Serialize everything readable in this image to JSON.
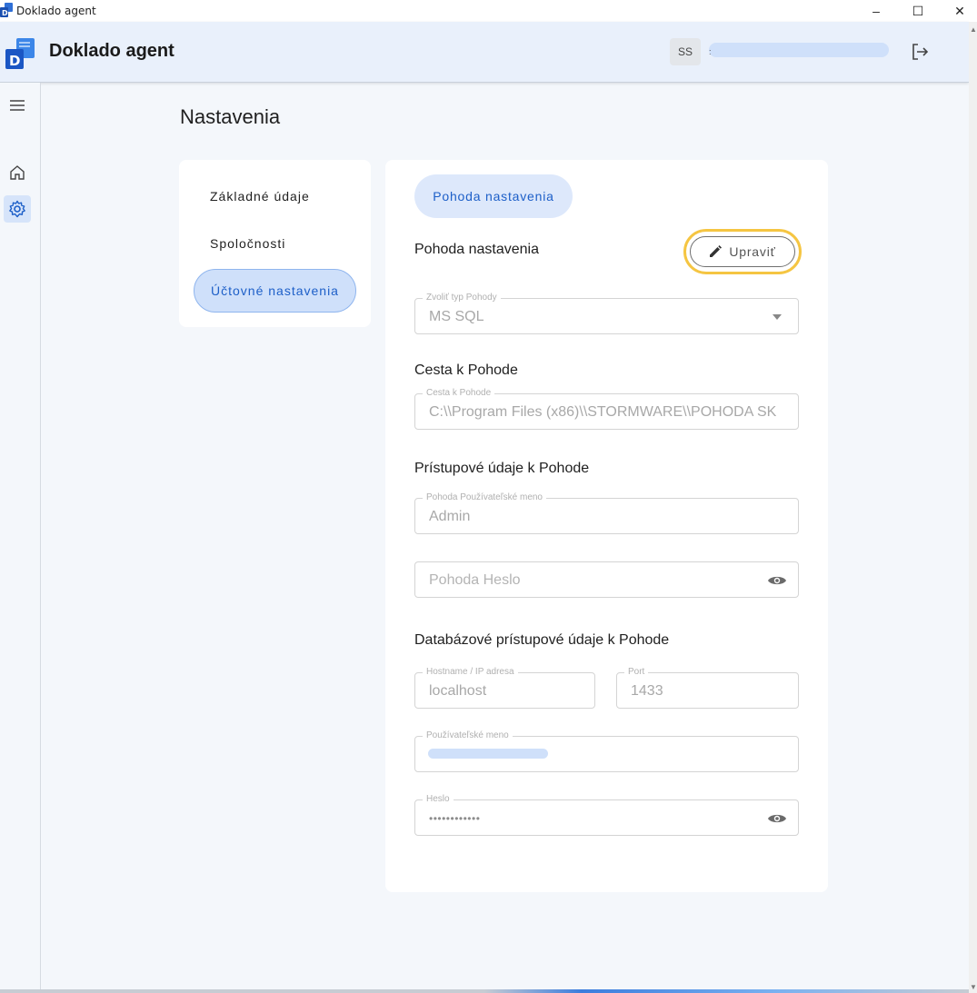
{
  "window": {
    "title": "Doklado agent",
    "minimize": "–",
    "maximize": "☐",
    "close": "✕"
  },
  "header": {
    "app_title": "Doklado agent",
    "avatar_initials": "SS",
    "logout_icon": "logout-icon"
  },
  "sidebar": {
    "icons": [
      "menu-icon",
      "home-icon",
      "settings-icon"
    ]
  },
  "page": {
    "title": "Nastavenia"
  },
  "settings_nav": {
    "items": [
      {
        "label": "Základné údaje"
      },
      {
        "label": "Spoločnosti"
      },
      {
        "label": "Účtovné nastavenia",
        "active": true
      }
    ]
  },
  "card": {
    "chip_label": "Pohoda nastavenia",
    "section_pohoda": "Pohoda nastavenia",
    "edit_label": "Upraviť",
    "type_field": {
      "label": "Zvoliť typ Pohody",
      "value": "MS SQL"
    },
    "section_path": "Cesta k Pohode",
    "path_field": {
      "label": "Cesta k Pohode",
      "value": "C:\\\\Program Files (x86)\\\\STORMWARE\\\\POHODA SK"
    },
    "section_access": "Prístupové údaje k Pohode",
    "user_field": {
      "label": "Pohoda Používateľské meno",
      "value": "Admin"
    },
    "password_field": {
      "placeholder": "Pohoda Heslo"
    },
    "section_db": "Databázové prístupové údaje k Pohode",
    "host_field": {
      "label": "Hostname / IP adresa",
      "value": "localhost"
    },
    "port_field": {
      "label": "Port",
      "value": "1433"
    },
    "db_user_field": {
      "label": "Používateľské meno"
    },
    "db_password_field": {
      "label": "Heslo",
      "value": "••••••••••••"
    }
  },
  "colors": {
    "accent": "#1d5fc8",
    "active_bg": "#cfe0fa",
    "highlight": "#f5c542",
    "header_bg": "#e9f0fb"
  }
}
